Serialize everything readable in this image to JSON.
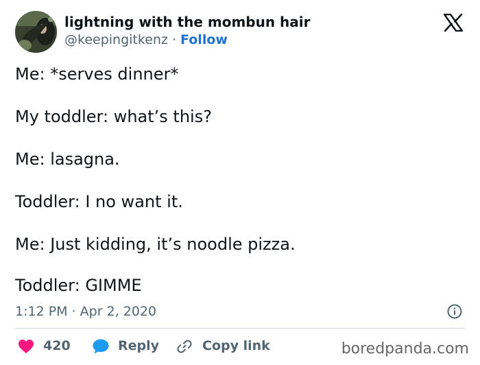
{
  "author": {
    "name": "lightning with the mombun hair",
    "handle": "@keepingitkenz",
    "separator": "·",
    "follow_label": "Follow"
  },
  "tweet": {
    "lines": [
      "Me: *serves dinner*",
      "My toddler: what’s this?",
      "Me: lasagna.",
      "Toddler: I no want it.",
      "Me: Just kidding, it’s noodle pizza.",
      "Toddler: GIMME"
    ],
    "timestamp": "1:12 PM · Apr 2, 2020"
  },
  "actions": {
    "like_count": "420",
    "reply_label": "Reply",
    "copy_link_label": "Copy link"
  },
  "watermark": "boredpanda.com",
  "icons": {
    "brand": "x-logo-icon",
    "info": "info-icon",
    "like": "heart-icon",
    "reply": "speech-bubble-icon",
    "copy_link": "link-icon"
  },
  "colors": {
    "text": "#0f1419",
    "secondary": "#536471",
    "follow": "#1d74d2",
    "like": "#f91880",
    "reply": "#1d9bf0",
    "divider": "#cfd9de"
  }
}
